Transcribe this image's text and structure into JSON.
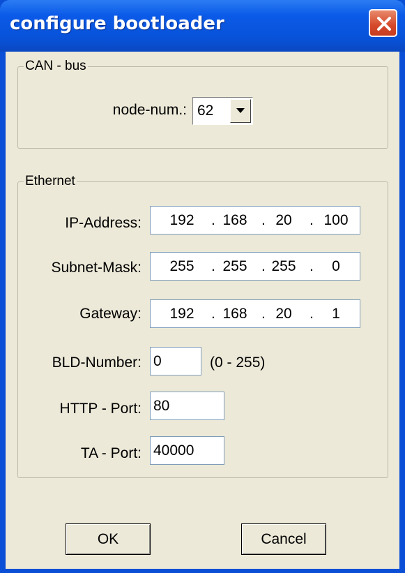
{
  "window": {
    "title": "configure bootloader"
  },
  "can_group": {
    "legend": "CAN - bus",
    "node_label": "node-num.:",
    "node_value": "62"
  },
  "ethernet_group": {
    "legend": "Ethernet",
    "ip_label": "IP-Address:",
    "ip": [
      "192",
      "168",
      "20",
      "100"
    ],
    "subnet_label": "Subnet-Mask:",
    "subnet": [
      "255",
      "255",
      "255",
      "0"
    ],
    "gateway_label": "Gateway:",
    "gateway": [
      "192",
      "168",
      "20",
      "1"
    ],
    "bld_label": "BLD-Number:",
    "bld_value": "0",
    "bld_range": "(0 - 255)",
    "http_label": "HTTP - Port:",
    "http_value": "80",
    "ta_label": "TA - Port:",
    "ta_value": "40000"
  },
  "buttons": {
    "ok": "OK",
    "cancel": "Cancel"
  },
  "dot": "."
}
